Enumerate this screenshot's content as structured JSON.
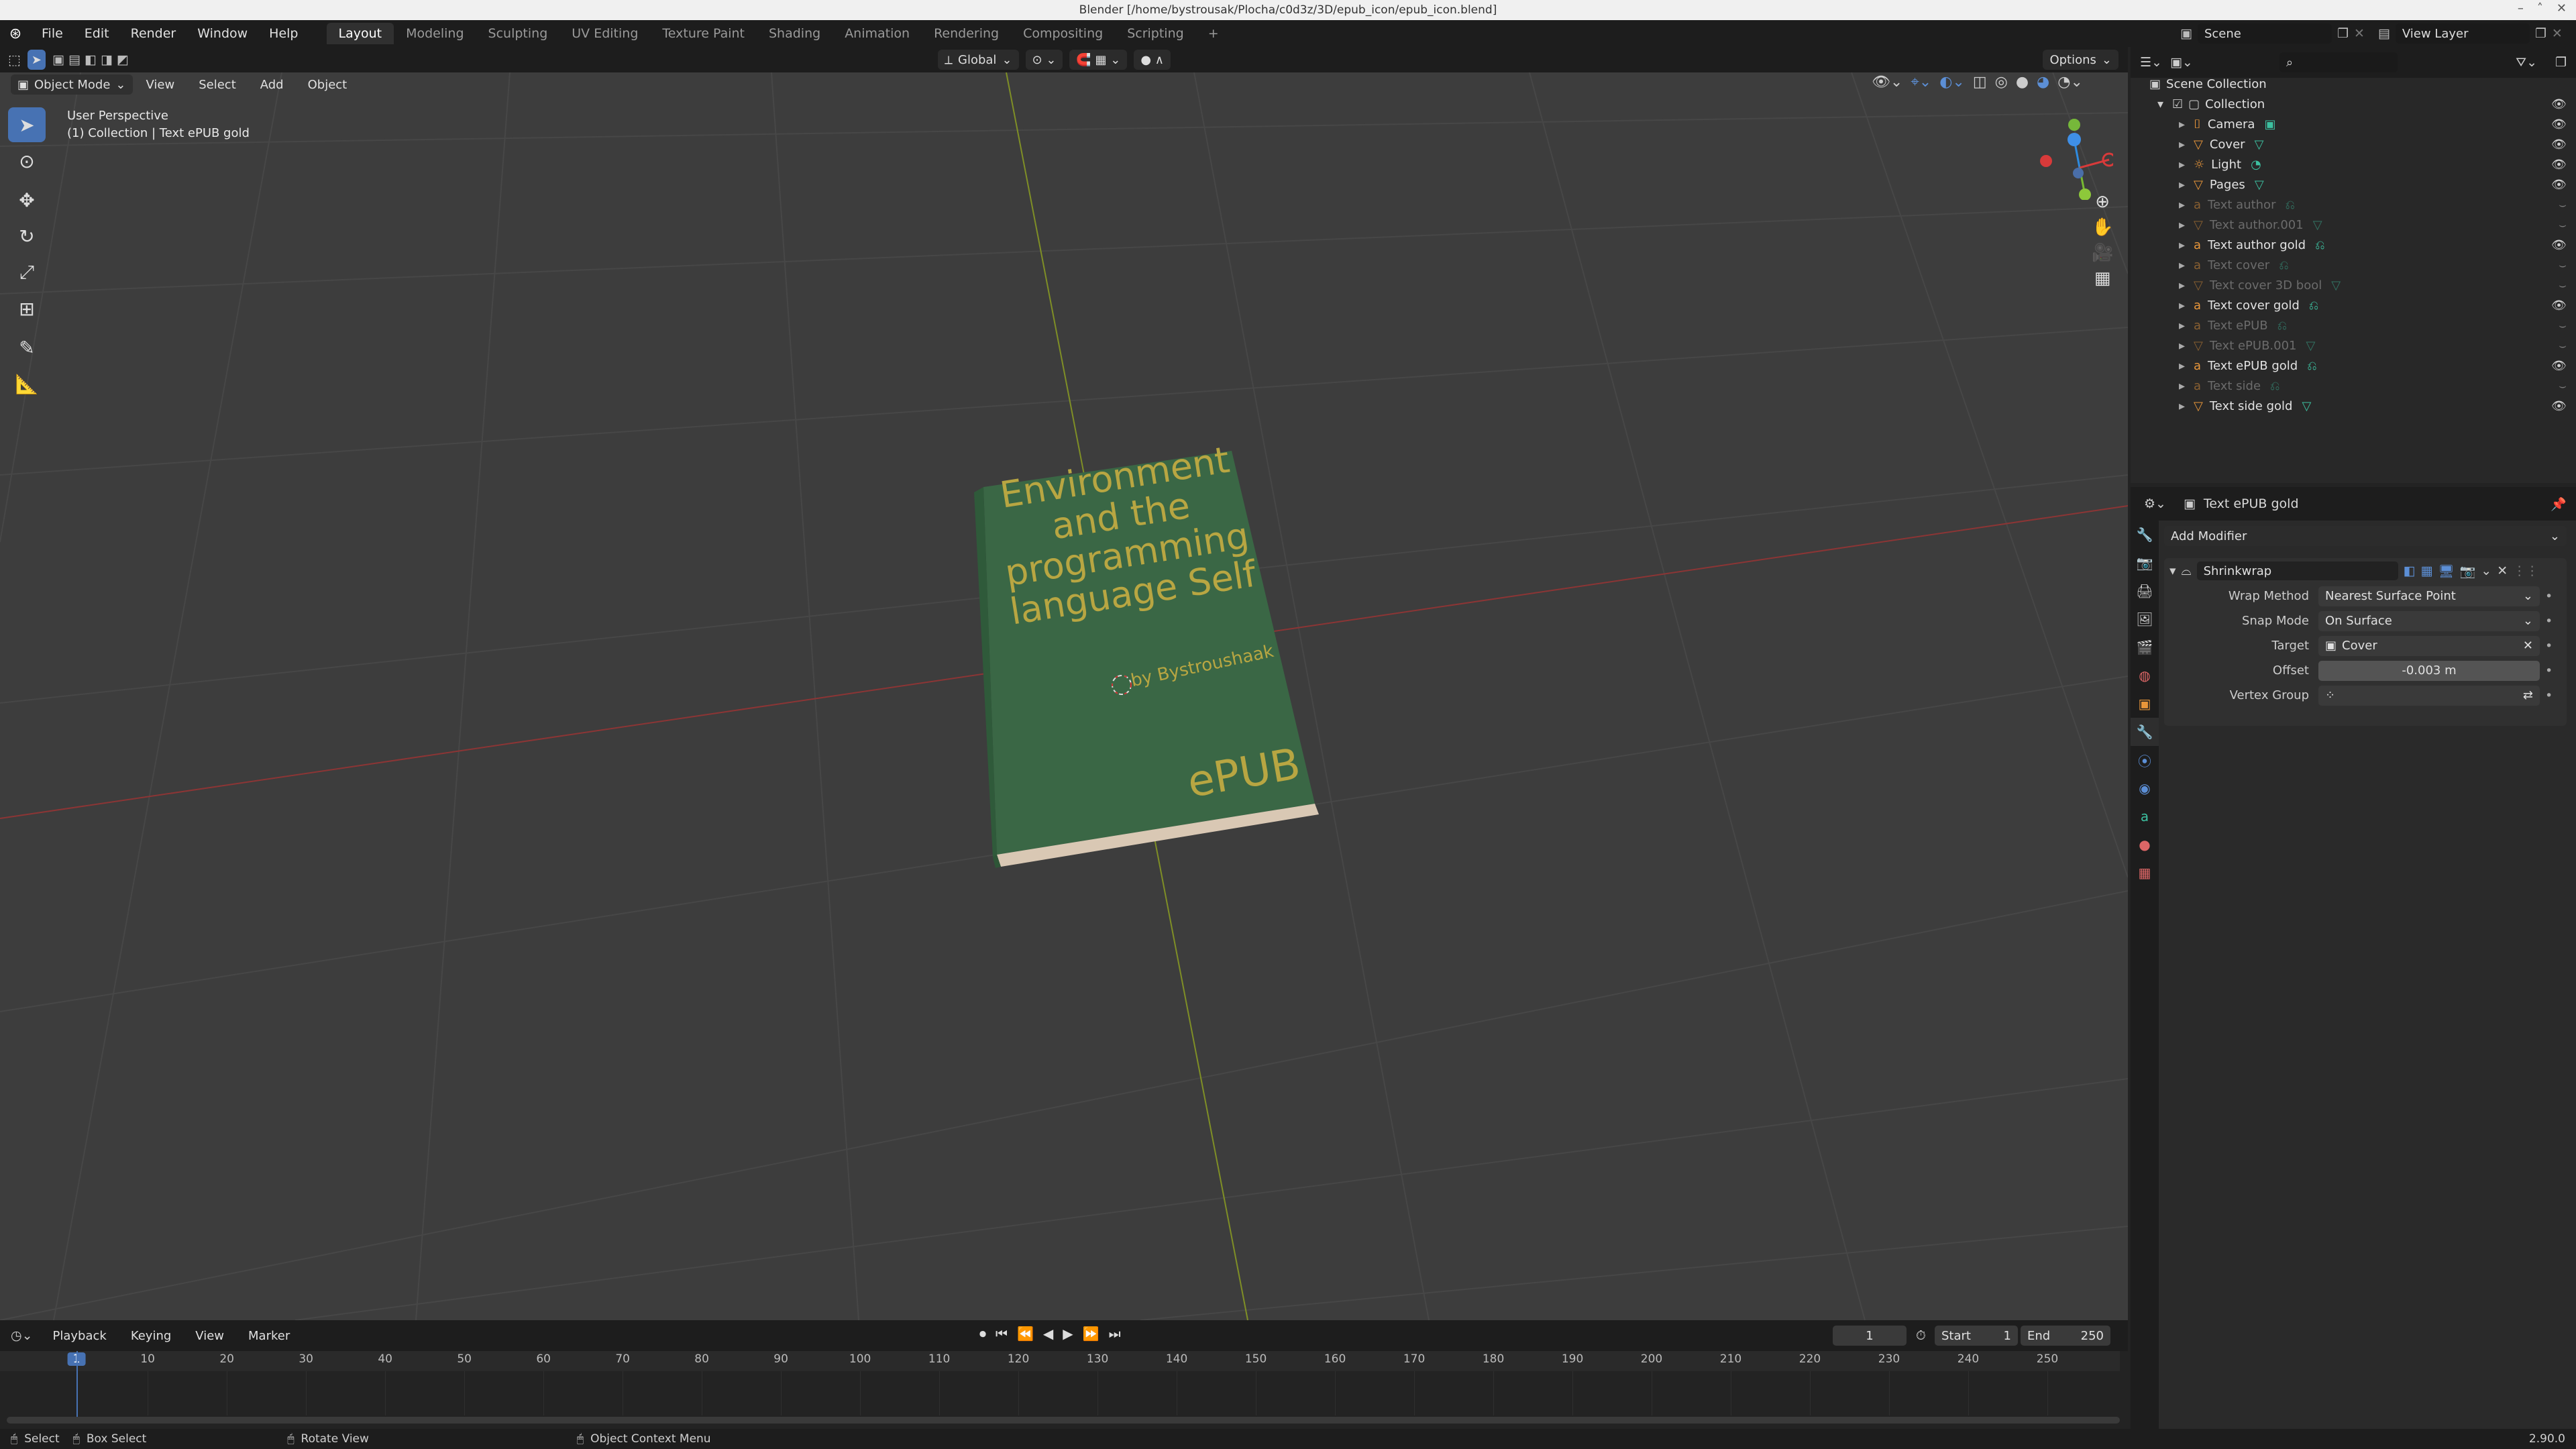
{
  "window": {
    "title": "Blender [/home/bystrousak/Plocha/c0d3z/3D/epub_icon/epub_icon.blend]"
  },
  "menu": [
    "File",
    "Edit",
    "Render",
    "Window",
    "Help"
  ],
  "workspaces": [
    "Layout",
    "Modeling",
    "Sculpting",
    "UV Editing",
    "Texture Paint",
    "Shading",
    "Animation",
    "Rendering",
    "Compositing",
    "Scripting"
  ],
  "active_workspace": "Layout",
  "scene": {
    "label": "Scene",
    "view_layer": "View Layer"
  },
  "viewport_header": {
    "mode": "Object Mode",
    "menus": [
      "View",
      "Select",
      "Add",
      "Object"
    ],
    "orientation": "Global",
    "options": "Options"
  },
  "viewport": {
    "perspective": "User Perspective",
    "collection_info": "(1) Collection | Text ePUB gold",
    "book": {
      "title_lines": [
        "Environment",
        "and the",
        "programming",
        "language Self"
      ],
      "author": "by Bystroushaak",
      "badge": "ePUB"
    }
  },
  "outliner": {
    "root": "Scene Collection",
    "collection": "Collection",
    "items": [
      {
        "name": "Camera",
        "dim": false,
        "type": "camera"
      },
      {
        "name": "Cover",
        "dim": false,
        "type": "mesh"
      },
      {
        "name": "Light",
        "dim": false,
        "type": "light"
      },
      {
        "name": "Pages",
        "dim": false,
        "type": "mesh"
      },
      {
        "name": "Text author",
        "dim": true,
        "type": "text"
      },
      {
        "name": "Text author.001",
        "dim": true,
        "type": "mesh"
      },
      {
        "name": "Text author gold",
        "dim": false,
        "type": "text"
      },
      {
        "name": "Text cover",
        "dim": true,
        "type": "text"
      },
      {
        "name": "Text cover 3D bool",
        "dim": true,
        "type": "mesh"
      },
      {
        "name": "Text cover gold",
        "dim": false,
        "type": "text"
      },
      {
        "name": "Text ePUB",
        "dim": true,
        "type": "text"
      },
      {
        "name": "Text ePUB.001",
        "dim": true,
        "type": "mesh"
      },
      {
        "name": "Text ePUB gold",
        "dim": false,
        "type": "text"
      },
      {
        "name": "Text side",
        "dim": true,
        "type": "text"
      },
      {
        "name": "Text side gold",
        "dim": false,
        "type": "mesh"
      }
    ]
  },
  "properties": {
    "object_name": "Text ePUB gold",
    "add_modifier": "Add Modifier",
    "modifier": {
      "name": "Shrinkwrap",
      "fields": [
        {
          "label": "Wrap Method",
          "value": "Nearest Surface Point"
        },
        {
          "label": "Snap Mode",
          "value": "On Surface"
        },
        {
          "label": "Target",
          "value": "Cover"
        },
        {
          "label": "Offset",
          "value": "-0.003 m"
        },
        {
          "label": "Vertex Group",
          "value": ""
        }
      ]
    }
  },
  "timeline": {
    "menus": [
      "Playback",
      "Keying",
      "View",
      "Marker"
    ],
    "current_frame": "1",
    "start_label": "Start",
    "start": "1",
    "end_label": "End",
    "end": "250",
    "ticks": [
      "1",
      "10",
      "20",
      "30",
      "40",
      "50",
      "60",
      "70",
      "80",
      "90",
      "100",
      "110",
      "120",
      "130",
      "140",
      "150",
      "160",
      "170",
      "180",
      "190",
      "200",
      "210",
      "220",
      "230",
      "240",
      "250"
    ]
  },
  "status": {
    "select": "Select",
    "box_select": "Box Select",
    "rotate": "Rotate View",
    "context": "Object Context Menu",
    "version": "2.90.0"
  },
  "colors": {
    "accent": "#4772b3",
    "book_cover": "#3d6a47",
    "gold_text": "#b8a642",
    "x_axis": "#9c3a3a",
    "y_axis": "#8a9a2a"
  }
}
